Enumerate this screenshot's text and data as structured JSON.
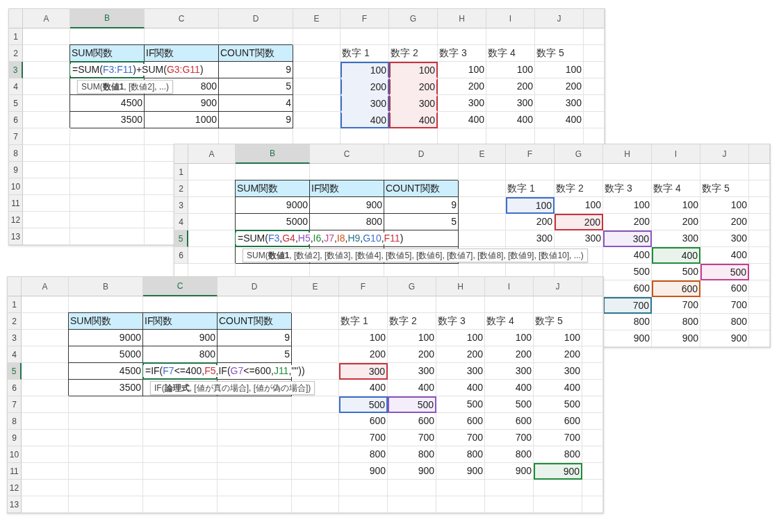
{
  "sheets": [
    {
      "columns": [
        {
          "label": "A",
          "selected": false
        },
        {
          "label": "B",
          "selected": true
        },
        {
          "label": "C",
          "selected": false
        },
        {
          "label": "D",
          "selected": false
        },
        {
          "label": "E",
          "selected": false
        },
        {
          "label": "F",
          "selected": false
        },
        {
          "label": "G",
          "selected": false
        },
        {
          "label": "H",
          "selected": false
        },
        {
          "label": "I",
          "selected": false
        },
        {
          "label": "J",
          "selected": false
        }
      ],
      "rows": [
        {
          "header": {
            "label": "1",
            "selected": false
          }
        },
        {
          "header": {
            "label": "2",
            "selected": false
          },
          "cells": [
            null,
            {
              "kind": "th",
              "text": "SUM関数"
            },
            {
              "kind": "th",
              "text": "IF関数"
            },
            {
              "kind": "th",
              "text": "COUNT関数"
            },
            null,
            {
              "kind": "label",
              "text": "数字 1"
            },
            {
              "kind": "label",
              "text": "数字 2"
            },
            {
              "kind": "label",
              "text": "数字 3"
            },
            {
              "kind": "label",
              "text": "数字 4"
            },
            {
              "kind": "label",
              "text": "数字 5"
            }
          ]
        },
        {
          "header": {
            "label": "3",
            "selected": true
          },
          "cells": [
            null,
            {
              "kind": "formula",
              "parts": [
                {
                  "text": "=SUM("
                },
                {
                  "text": "F3:F11",
                  "color": "#3d6fc9"
                },
                {
                  "text": ")+SUM("
                },
                {
                  "text": "G3:G11",
                  "color": "#c8333d"
                },
                {
                  "text": ")"
                }
              ],
              "tooltip": "SUM(**数値1**, [数値2], ...)"
            },
            {
              "kind": "td"
            },
            {
              "kind": "td",
              "text": "9"
            },
            null,
            {
              "kind": "num",
              "text": "100",
              "color": "#3d6fc9"
            },
            {
              "kind": "num",
              "text": "100",
              "color": "#c8333d"
            },
            {
              "kind": "num",
              "text": "100"
            },
            {
              "kind": "num",
              "text": "100"
            },
            {
              "kind": "num",
              "text": "100"
            }
          ]
        },
        {
          "header": {
            "label": "4",
            "selected": false
          },
          "cells": [
            null,
            {
              "kind": "td"
            },
            {
              "kind": "td",
              "text": "800"
            },
            {
              "kind": "td",
              "text": "5"
            },
            null,
            {
              "kind": "num",
              "text": "200",
              "color": "#3d6fc9"
            },
            {
              "kind": "num",
              "text": "200",
              "color": "#c8333d"
            },
            {
              "kind": "num",
              "text": "200"
            },
            {
              "kind": "num",
              "text": "200"
            },
            {
              "kind": "num",
              "text": "200"
            }
          ]
        },
        {
          "header": {
            "label": "5",
            "selected": false
          },
          "cells": [
            null,
            {
              "kind": "td",
              "text": "4500"
            },
            {
              "kind": "td",
              "text": "900"
            },
            {
              "kind": "td",
              "text": "4"
            },
            null,
            {
              "kind": "num",
              "text": "300",
              "color": "#3d6fc9"
            },
            {
              "kind": "num",
              "text": "300",
              "color": "#c8333d"
            },
            {
              "kind": "num",
              "text": "300"
            },
            {
              "kind": "num",
              "text": "300"
            },
            {
              "kind": "num",
              "text": "300"
            }
          ]
        },
        {
          "header": {
            "label": "6",
            "selected": false
          },
          "cells": [
            null,
            {
              "kind": "td",
              "text": "3500"
            },
            {
              "kind": "td",
              "text": "1000"
            },
            {
              "kind": "td",
              "text": "9"
            },
            null,
            {
              "kind": "num",
              "text": "400",
              "color": "#3d6fc9"
            },
            {
              "kind": "num",
              "text": "400",
              "color": "#c8333d"
            },
            {
              "kind": "num",
              "text": "400"
            },
            {
              "kind": "num",
              "text": "400"
            },
            {
              "kind": "num",
              "text": "400"
            }
          ]
        },
        {
          "header": {
            "label": "7",
            "selected": false
          }
        },
        {
          "header": {
            "label": "8",
            "selected": false
          }
        },
        {
          "header": {
            "label": "9",
            "selected": false
          }
        },
        {
          "header": {
            "label": "10",
            "selected": false
          }
        },
        {
          "header": {
            "label": "11",
            "selected": false
          }
        },
        {
          "header": {
            "label": "12",
            "selected": false
          }
        },
        {
          "header": {
            "label": "13",
            "selected": false
          }
        }
      ]
    },
    {
      "columns": [
        {
          "label": "A",
          "selected": false
        },
        {
          "label": "B",
          "selected": true
        },
        {
          "label": "C",
          "selected": false
        },
        {
          "label": "D",
          "selected": false
        },
        {
          "label": "E",
          "selected": false
        },
        {
          "label": "F",
          "selected": false
        },
        {
          "label": "G",
          "selected": false
        },
        {
          "label": "H",
          "selected": false
        },
        {
          "label": "I",
          "selected": false
        },
        {
          "label": "J",
          "selected": false
        }
      ],
      "rows": [
        {
          "header": {
            "label": "1",
            "selected": false
          }
        },
        {
          "header": {
            "label": "2",
            "selected": false
          },
          "cells": [
            null,
            {
              "kind": "th",
              "text": "SUM関数"
            },
            {
              "kind": "th",
              "text": "IF関数"
            },
            {
              "kind": "th",
              "text": "COUNT関数"
            },
            null,
            {
              "kind": "label",
              "text": "数字 1"
            },
            {
              "kind": "label",
              "text": "数字 2"
            },
            {
              "kind": "label",
              "text": "数字 3"
            },
            {
              "kind": "label",
              "text": "数字 4"
            },
            {
              "kind": "label",
              "text": "数字 5"
            }
          ]
        },
        {
          "header": {
            "label": "3",
            "selected": false
          },
          "cells": [
            null,
            {
              "kind": "td",
              "text": "9000"
            },
            {
              "kind": "td",
              "text": "900"
            },
            {
              "kind": "td",
              "text": "9"
            },
            null,
            {
              "kind": "num",
              "text": "100",
              "color": "#3d6fc9"
            },
            {
              "kind": "num",
              "text": "100"
            },
            {
              "kind": "num",
              "text": "100"
            },
            {
              "kind": "num",
              "text": "100"
            },
            {
              "kind": "num",
              "text": "100"
            }
          ]
        },
        {
          "header": {
            "label": "4",
            "selected": false
          },
          "cells": [
            null,
            {
              "kind": "td",
              "text": "5000"
            },
            {
              "kind": "td",
              "text": "800"
            },
            {
              "kind": "td",
              "text": "5"
            },
            null,
            {
              "kind": "num",
              "text": "200"
            },
            {
              "kind": "num",
              "text": "200",
              "color": "#c8333d"
            },
            {
              "kind": "num",
              "text": "200"
            },
            {
              "kind": "num",
              "text": "200"
            },
            {
              "kind": "num",
              "text": "200"
            }
          ]
        },
        {
          "header": {
            "label": "5",
            "selected": true
          },
          "cells": [
            null,
            {
              "kind": "formula",
              "parts": [
                {
                  "text": "=SUM("
                },
                {
                  "text": "F3",
                  "color": "#3d6fc9"
                },
                {
                  "text": ","
                },
                {
                  "text": "G4",
                  "color": "#c8333d"
                },
                {
                  "text": ","
                },
                {
                  "text": "H5",
                  "color": "#8a56c2"
                },
                {
                  "text": ","
                },
                {
                  "text": "I6",
                  "color": "#1f8b3b"
                },
                {
                  "text": ","
                },
                {
                  "text": "J7",
                  "color": "#c23f94"
                },
                {
                  "text": ","
                },
                {
                  "text": "I8",
                  "color": "#c9561a"
                },
                {
                  "text": ","
                },
                {
                  "text": "H9",
                  "color": "#2b7591"
                },
                {
                  "text": ","
                },
                {
                  "text": "G10",
                  "color": "#3d6fc9"
                },
                {
                  "text": ","
                },
                {
                  "text": "F11",
                  "color": "#c8333d"
                },
                {
                  "text": ")"
                }
              ],
              "tooltip": "SUM(**数値1**, [数値2], [数値3], [数値4], [数値5], [数値6], [数値7], [数値8], [数値9], [数値10], ...)"
            },
            {
              "kind": "td"
            },
            {
              "kind": "td"
            },
            null,
            {
              "kind": "num",
              "text": "300"
            },
            {
              "kind": "num",
              "text": "300"
            },
            {
              "kind": "num",
              "text": "300",
              "color": "#8a56c2"
            },
            {
              "kind": "num",
              "text": "300"
            },
            {
              "kind": "num",
              "text": "300"
            }
          ]
        },
        {
          "header": {
            "label": "6",
            "selected": false
          },
          "cells": [
            null,
            {
              "kind": "td"
            },
            {
              "kind": "td"
            },
            {
              "kind": "td"
            },
            null,
            null,
            null,
            {
              "kind": "num",
              "text": "400"
            },
            {
              "kind": "num",
              "text": "400",
              "color": "#1f8b3b"
            },
            {
              "kind": "num",
              "text": "400"
            }
          ]
        },
        {
          "cells": [
            null,
            null,
            null,
            null,
            null,
            null,
            null,
            {
              "kind": "num",
              "text": "500"
            },
            {
              "kind": "num",
              "text": "500"
            },
            {
              "kind": "num",
              "text": "500",
              "color": "#c23f94"
            }
          ]
        },
        {
          "cells": [
            null,
            null,
            null,
            null,
            null,
            null,
            null,
            {
              "kind": "num",
              "text": "600"
            },
            {
              "kind": "num",
              "text": "600",
              "color": "#c9561a"
            },
            {
              "kind": "num",
              "text": "600"
            }
          ]
        },
        {
          "cells": [
            null,
            null,
            null,
            null,
            null,
            null,
            null,
            {
              "kind": "num",
              "text": "700",
              "color": "#2b7591"
            },
            {
              "kind": "num",
              "text": "700"
            },
            {
              "kind": "num",
              "text": "700"
            }
          ]
        },
        {
          "cells": [
            null,
            null,
            null,
            null,
            null,
            null,
            null,
            {
              "kind": "num",
              "text": "800"
            },
            {
              "kind": "num",
              "text": "800"
            },
            {
              "kind": "num",
              "text": "800"
            }
          ]
        },
        {
          "cells": [
            null,
            null,
            null,
            null,
            null,
            null,
            null,
            {
              "kind": "num",
              "text": "900"
            },
            {
              "kind": "num",
              "text": "900"
            },
            {
              "kind": "num",
              "text": "900"
            }
          ]
        }
      ]
    },
    {
      "columns": [
        {
          "label": "A",
          "selected": false
        },
        {
          "label": "B",
          "selected": false
        },
        {
          "label": "C",
          "selected": true
        },
        {
          "label": "D",
          "selected": false
        },
        {
          "label": "E",
          "selected": false
        },
        {
          "label": "F",
          "selected": false
        },
        {
          "label": "G",
          "selected": false
        },
        {
          "label": "H",
          "selected": false
        },
        {
          "label": "I",
          "selected": false
        },
        {
          "label": "J",
          "selected": false
        }
      ],
      "rows": [
        {
          "header": {
            "label": "1",
            "selected": false
          }
        },
        {
          "header": {
            "label": "2",
            "selected": false
          },
          "cells": [
            null,
            {
              "kind": "th",
              "text": "SUM関数"
            },
            {
              "kind": "th",
              "text": "IF関数"
            },
            {
              "kind": "th",
              "text": "COUNT関数"
            },
            null,
            {
              "kind": "label",
              "text": "数字 1"
            },
            {
              "kind": "label",
              "text": "数字 2"
            },
            {
              "kind": "label",
              "text": "数字 3"
            },
            {
              "kind": "label",
              "text": "数字 4"
            },
            {
              "kind": "label",
              "text": "数字 5"
            }
          ]
        },
        {
          "header": {
            "label": "3",
            "selected": false
          },
          "cells": [
            null,
            {
              "kind": "td",
              "text": "9000"
            },
            {
              "kind": "td",
              "text": "900"
            },
            {
              "kind": "td",
              "text": "9"
            },
            null,
            {
              "kind": "num",
              "text": "100"
            },
            {
              "kind": "num",
              "text": "100"
            },
            {
              "kind": "num",
              "text": "100"
            },
            {
              "kind": "num",
              "text": "100"
            },
            {
              "kind": "num",
              "text": "100"
            }
          ]
        },
        {
          "header": {
            "label": "4",
            "selected": false
          },
          "cells": [
            null,
            {
              "kind": "td",
              "text": "5000"
            },
            {
              "kind": "td",
              "text": "800"
            },
            {
              "kind": "td",
              "text": "5"
            },
            null,
            {
              "kind": "num",
              "text": "200"
            },
            {
              "kind": "num",
              "text": "200"
            },
            {
              "kind": "num",
              "text": "200"
            },
            {
              "kind": "num",
              "text": "200"
            },
            {
              "kind": "num",
              "text": "200"
            }
          ]
        },
        {
          "header": {
            "label": "5",
            "selected": true
          },
          "cells": [
            null,
            {
              "kind": "td",
              "text": "4500"
            },
            {
              "kind": "formula",
              "parts": [
                {
                  "text": "=IF("
                },
                {
                  "text": "F7",
                  "color": "#3d6fc9"
                },
                {
                  "text": "<=400,"
                },
                {
                  "text": "F5",
                  "color": "#c8333d"
                },
                {
                  "text": ",IF("
                },
                {
                  "text": "G7",
                  "color": "#8a56c2"
                },
                {
                  "text": "<=600,"
                },
                {
                  "text": "J11",
                  "color": "#1f8b3b"
                },
                {
                  "text": ",\"\"))"
                }
              ],
              "tooltip": "IF(**論理式**, [値が真の場合], [値が偽の場合])"
            },
            {
              "kind": "td"
            },
            null,
            {
              "kind": "num",
              "text": "300",
              "color": "#c8333d"
            },
            {
              "kind": "num",
              "text": "300"
            },
            {
              "kind": "num",
              "text": "300"
            },
            {
              "kind": "num",
              "text": "300"
            },
            {
              "kind": "num",
              "text": "300"
            }
          ]
        },
        {
          "header": {
            "label": "6",
            "selected": false
          },
          "cells": [
            null,
            {
              "kind": "td",
              "text": "3500"
            },
            {
              "kind": "td"
            },
            {
              "kind": "td"
            },
            null,
            {
              "kind": "num",
              "text": "400"
            },
            {
              "kind": "num",
              "text": "400"
            },
            {
              "kind": "num",
              "text": "400"
            },
            {
              "kind": "num",
              "text": "400"
            },
            {
              "kind": "num",
              "text": "400"
            }
          ]
        },
        {
          "header": {
            "label": "7",
            "selected": false
          },
          "cells": [
            null,
            null,
            null,
            null,
            null,
            {
              "kind": "num",
              "text": "500",
              "color": "#3d6fc9"
            },
            {
              "kind": "num",
              "text": "500",
              "color": "#8a56c2"
            },
            {
              "kind": "num",
              "text": "500"
            },
            {
              "kind": "num",
              "text": "500"
            },
            {
              "kind": "num",
              "text": "500"
            }
          ]
        },
        {
          "header": {
            "label": "8",
            "selected": false
          },
          "cells": [
            null,
            null,
            null,
            null,
            null,
            {
              "kind": "num",
              "text": "600"
            },
            {
              "kind": "num",
              "text": "600"
            },
            {
              "kind": "num",
              "text": "600"
            },
            {
              "kind": "num",
              "text": "600"
            },
            {
              "kind": "num",
              "text": "600"
            }
          ]
        },
        {
          "header": {
            "label": "9",
            "selected": false
          },
          "cells": [
            null,
            null,
            null,
            null,
            null,
            {
              "kind": "num",
              "text": "700"
            },
            {
              "kind": "num",
              "text": "700"
            },
            {
              "kind": "num",
              "text": "700"
            },
            {
              "kind": "num",
              "text": "700"
            },
            {
              "kind": "num",
              "text": "700"
            }
          ]
        },
        {
          "header": {
            "label": "10",
            "selected": false
          },
          "cells": [
            null,
            null,
            null,
            null,
            null,
            {
              "kind": "num",
              "text": "800"
            },
            {
              "kind": "num",
              "text": "800"
            },
            {
              "kind": "num",
              "text": "800"
            },
            {
              "kind": "num",
              "text": "800"
            },
            {
              "kind": "num",
              "text": "800"
            }
          ]
        },
        {
          "header": {
            "label": "11",
            "selected": false
          },
          "cells": [
            null,
            null,
            null,
            null,
            null,
            {
              "kind": "num",
              "text": "900"
            },
            {
              "kind": "num",
              "text": "900"
            },
            {
              "kind": "num",
              "text": "900"
            },
            {
              "kind": "num",
              "text": "900"
            },
            {
              "kind": "num",
              "text": "900",
              "color": "#1f8b3b"
            }
          ]
        },
        {
          "header": {
            "label": "12",
            "selected": false
          }
        },
        {
          "header": {
            "label": "13",
            "selected": false
          }
        }
      ]
    }
  ]
}
